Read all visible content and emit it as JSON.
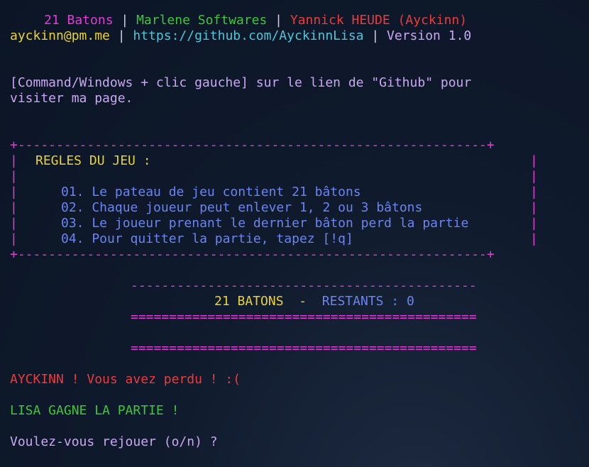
{
  "header": {
    "app_name": "21 Batons",
    "sep": " | ",
    "company": "Marlene Softwares",
    "author": "Yannick HEUDE (Ayckinn)",
    "email": "ayckinn@pm.me",
    "github_url": "https://github.com/AyckinnLisa",
    "version": "Version 1.0"
  },
  "hint": {
    "line1": "[Command/Windows + clic gauche] sur le lien de \"Github\" pour",
    "line2": "visiter ma page."
  },
  "rules_box": {
    "border_top": "+-------------------------------------------------------------+",
    "border_bottom": "+-------------------------------------------------------------+",
    "side": "|",
    "title": "REGLES DU JEU :",
    "rules": [
      "01. Le pateau de jeu contient 21 bâtons",
      "02. Chaque joueur peut enlever 1, 2 ou 3 bâtons",
      "03. Le joueur prenant le dernier bâton perd la partie",
      "04. Pour quitter la partie, tapez [!q]"
    ]
  },
  "board": {
    "dash_line": "---------------------------------------------",
    "title": "21 BATONS",
    "dash": "-",
    "remaining_label": "RESTANTS : 0",
    "eq_line": "============================================="
  },
  "status": {
    "lose_message": "AYCKINN ! Vous avez perdu ! :(",
    "win_message": "LISA GAGNE LA PARTIE !",
    "prompt": "Voulez-vous rejouer (o/n) ?"
  },
  "colors": {
    "background": "#0b1526",
    "magenta": "#e23bd6",
    "green": "#3fc63a",
    "red": "#ef3a3a",
    "yellow": "#e9d23a",
    "cyan": "#52c5d6",
    "lavender": "#c9a8f2",
    "blue": "#6c84f0"
  }
}
